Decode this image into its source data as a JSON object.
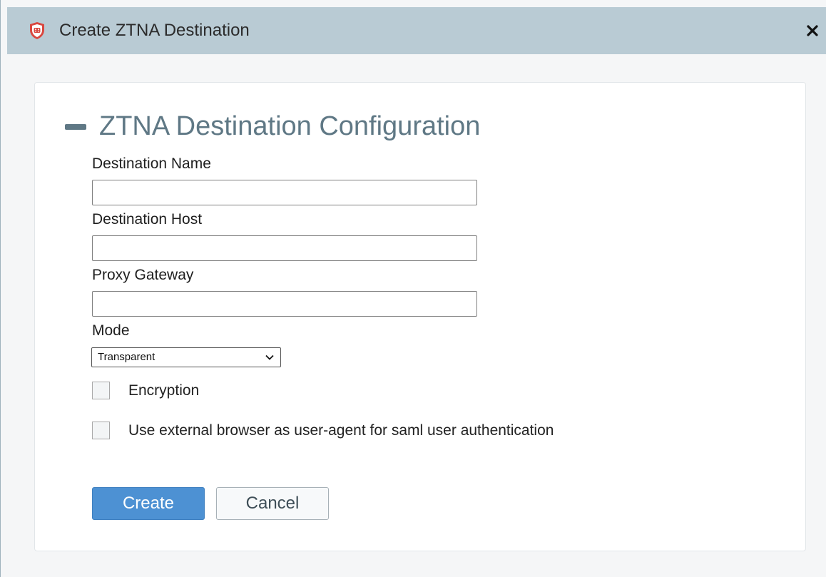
{
  "window": {
    "title": "Create ZTNA Destination",
    "logo_icon": "forticlient-shield-icon",
    "close_icon": "close-icon"
  },
  "section": {
    "title": "ZTNA Destination Configuration",
    "toggle_icon": "collapse-minus-icon"
  },
  "fields": {
    "destination_name": {
      "label": "Destination Name",
      "value": "",
      "placeholder": ""
    },
    "destination_host": {
      "label": "Destination Host",
      "value": "",
      "placeholder": ""
    },
    "proxy_gateway": {
      "label": "Proxy Gateway",
      "value": "",
      "placeholder": ""
    },
    "mode": {
      "label": "Mode",
      "selected": "Transparent"
    }
  },
  "options": {
    "encryption": {
      "label": "Encryption",
      "checked": false
    },
    "external_browser": {
      "label": "Use external browser as user-agent for saml user authentication",
      "checked": false
    }
  },
  "actions": {
    "create_label": "Create",
    "cancel_label": "Cancel"
  },
  "colors": {
    "titlebar": "#b9cbd4",
    "logo": "#d9473f",
    "section_title": "#5f7885",
    "primary_button": "#4d91d3"
  }
}
